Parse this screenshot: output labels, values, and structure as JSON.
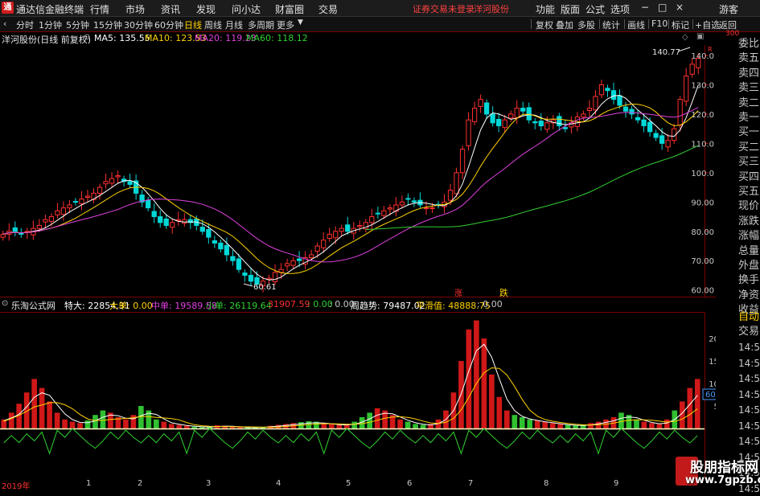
{
  "titlebar": {
    "logo": "通",
    "app_title": "通达信金融终端",
    "menus": [
      "行情",
      "市场",
      "资讯",
      "发现",
      "问小达",
      "财富圈",
      "交易"
    ],
    "login_status": "证券交易未登录",
    "stock_name": "洋河股份",
    "right_menus": [
      "功能",
      "版面",
      "公式",
      "选项"
    ],
    "window_buttons": [
      "−",
      "□",
      "×"
    ],
    "user": "游客"
  },
  "toolbar": {
    "periods": [
      "分时",
      "1分钟",
      "5分钟",
      "15分钟",
      "30分钟",
      "60分钟",
      "日线",
      "周线",
      "月线",
      "多周期",
      "更多"
    ],
    "active_period": "日线",
    "right_items": [
      "复权",
      "叠加",
      "多股",
      "统计",
      "画线",
      "F10",
      "标记",
      "+自选",
      "返回"
    ]
  },
  "main_info": {
    "title": "洋河股份(日线 前复权)",
    "ma": [
      {
        "label": "MA5: 135.55",
        "color": "#ffffff"
      },
      {
        "label": "MA10: 123.53",
        "color": "#ffd200"
      },
      {
        "label": "MA20: 119.23",
        "color": "#e040e0"
      },
      {
        "label": "MA60: 118.12",
        "color": "#30d030"
      }
    ]
  },
  "main_axis": {
    "ticks": [
      "140.0",
      "130.0",
      "120.0",
      "110.0",
      "100.0",
      "90.00",
      "80.00",
      "70.00",
      "60.00"
    ],
    "corner_labels": [
      "R",
      "300"
    ]
  },
  "annotations": {
    "high": "140.77",
    "low": "60.61",
    "marker_up": "涨",
    "marker_down": "跌"
  },
  "sub_info": {
    "title": "乐淘公式网",
    "items": [
      {
        "label": "特大: 22854.31",
        "color": "#ffffff"
      },
      {
        "label": "大单: 0.00",
        "color": "#ffd200"
      },
      {
        "label": "中单: 19589.58",
        "color": "#e040e0"
      },
      {
        "label": "小单: 26119.64",
        "color": "#30d030"
      },
      {
        "label": "31907.59",
        "color": "#ff3030"
      },
      {
        "label": ": 0.00",
        "color": "#30d030"
      },
      {
        "label": ": 0.00",
        "color": "#c8c8c8"
      },
      {
        "label": "周趋势: 79487.02",
        "color": "#ffffff"
      },
      {
        "label": "平滑值: 48888.75",
        "color": "#ffd200"
      },
      {
        "label": ": 0.00",
        "color": "#c8c8c8"
      }
    ]
  },
  "sub_axis": {
    "ticks": [
      "20000",
      "15000",
      "10000",
      "5000",
      "0"
    ],
    "current": "6036"
  },
  "x_axis": {
    "labels": [
      "2019年",
      "1",
      "2",
      "3",
      "4",
      "5",
      "6",
      "7",
      "8",
      "9"
    ]
  },
  "right_panel": {
    "items": [
      "委比",
      "卖五",
      "卖四",
      "卖三",
      "卖二",
      "卖一",
      "买一",
      "买二",
      "买三",
      "买四",
      "买五",
      "现价",
      "涨跌",
      "涨幅",
      "总量",
      "外盘",
      "换手",
      "净资",
      "收益"
    ],
    "auto": "自动",
    "trade": "交易",
    "times": [
      "14:56",
      "14:56",
      "14:56",
      "14:56",
      "14:56",
      "14:56",
      "14:56",
      "14:56",
      "14:56",
      "14:56"
    ]
  },
  "watermark": {
    "line1": "股朋指标网",
    "line2": "www.7gpzb.com"
  },
  "chart_data": {
    "type": "line",
    "title": "洋河股份(日线 前复权)",
    "ylim": [
      58,
      143
    ],
    "candles_close": [
      79,
      80,
      80,
      79,
      80,
      81,
      82,
      84,
      85,
      87,
      88,
      89,
      90,
      91,
      92,
      93,
      95,
      97,
      98,
      99,
      97,
      96,
      93,
      90,
      88,
      85,
      83,
      82,
      83,
      84,
      84,
      83,
      82,
      80,
      78,
      76,
      74,
      72,
      70,
      67,
      65,
      63,
      62,
      63,
      64,
      66,
      67,
      69,
      70,
      70,
      71,
      72,
      75,
      77,
      79,
      80,
      81,
      80,
      81,
      82,
      83,
      85,
      86,
      87,
      88,
      89,
      90,
      91,
      90,
      89,
      88,
      88,
      89,
      90,
      94,
      100,
      108,
      118,
      122,
      125,
      120,
      117,
      116,
      118,
      120,
      122,
      121,
      118,
      117,
      116,
      117,
      118,
      116,
      115,
      117,
      119,
      120,
      122,
      126,
      130,
      128,
      125,
      123,
      121,
      120,
      118,
      116,
      114,
      112,
      110,
      111,
      115,
      125,
      133,
      137,
      139
    ],
    "sub_red": [
      2000,
      3500,
      5500,
      8000,
      11000,
      9000,
      6000,
      3500,
      2000,
      1500,
      1200,
      1800,
      3000,
      4000,
      3500,
      2500,
      2000,
      3000,
      5000,
      4000,
      2000,
      1500,
      1000,
      800,
      600,
      400,
      300,
      500,
      700,
      600,
      400,
      300,
      200,
      300,
      400,
      600,
      800,
      1000,
      1200,
      1400,
      1600,
      1500,
      1200,
      1000,
      800,
      1000,
      1500,
      2500,
      3500,
      4500,
      4000,
      3000,
      2000,
      1500,
      1000,
      800,
      1000,
      2000,
      4000,
      8000,
      15000,
      22000,
      24000,
      20000,
      12000,
      7000,
      4000,
      3000,
      2500,
      2000,
      1800,
      1500,
      1200,
      1000,
      800,
      700,
      900,
      1200,
      1500,
      2000,
      2500,
      3500,
      3000,
      2000,
      1500,
      1200,
      1000,
      2000,
      4000,
      6000,
      9000,
      11000
    ]
  }
}
